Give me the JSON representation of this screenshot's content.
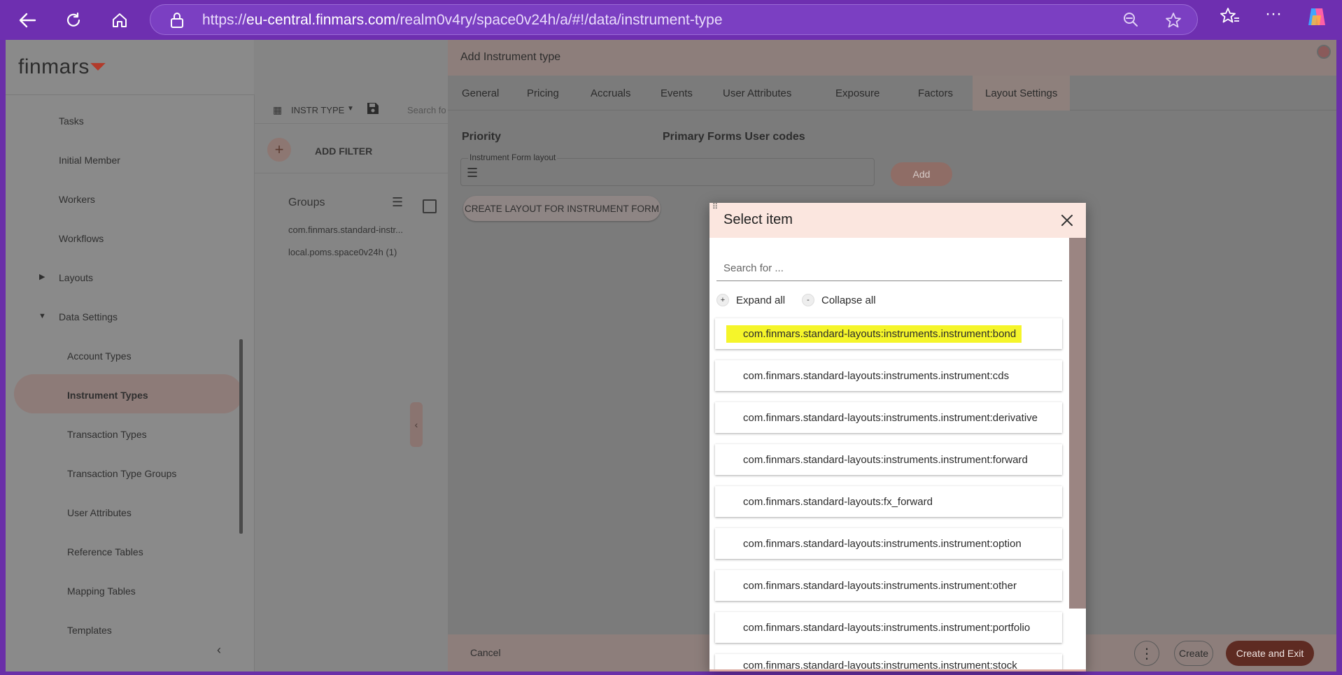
{
  "browser": {
    "url_prefix": "https://",
    "url_domain": "eu-central.finmars.com",
    "url_path": "/realm0v4ry/space0v24h/a/#!/data/instrument-type",
    "icons": [
      "back-arrow-icon",
      "refresh-icon",
      "home-icon",
      "lock-icon",
      "zoom-out-icon",
      "star-icon",
      "favorites-icon",
      "more-icon",
      "copilot-icon"
    ]
  },
  "app": {
    "logo": "finmars",
    "sidebar": {
      "items": [
        {
          "label": "Tasks"
        },
        {
          "label": "Initial Member"
        },
        {
          "label": "Workers"
        },
        {
          "label": "Workflows"
        },
        {
          "label": "Layouts"
        },
        {
          "label": "Data Settings"
        },
        {
          "label": "Account Types"
        },
        {
          "label": "Instrument Types"
        },
        {
          "label": "Transaction Types"
        },
        {
          "label": "Transaction Type Groups"
        },
        {
          "label": "User Attributes"
        },
        {
          "label": "Reference Tables"
        },
        {
          "label": "Mapping Tables"
        },
        {
          "label": "Templates"
        }
      ]
    },
    "midpanel": {
      "layout_name": "INSTR TYPE",
      "search_placeholder": "Search fo",
      "add_filter": "ADD FILTER",
      "groups_title": "Groups",
      "groups": [
        {
          "label": "com.finmars.standard-instr..."
        },
        {
          "label": "local.poms.space0v24h (1)"
        }
      ]
    }
  },
  "dialog": {
    "title": "Add Instrument type",
    "tabs": [
      {
        "label": "General"
      },
      {
        "label": "Pricing"
      },
      {
        "label": "Accruals"
      },
      {
        "label": "Events"
      },
      {
        "label": "User Attributes"
      },
      {
        "label": "Exposure"
      },
      {
        "label": "Factors"
      },
      {
        "label": "Layout Settings"
      }
    ],
    "active_tab": "Layout Settings",
    "priority_label": "Priority",
    "primary_forms_label": "Primary Forms User codes",
    "form_field_label": "Instrument Form layout",
    "add_button": "Add",
    "create_layout_button": "CREATE LAYOUT FOR INSTRUMENT FORM",
    "footer": {
      "cancel": "Cancel",
      "create": "Create",
      "create_and_exit": "Create and Exit"
    }
  },
  "modal": {
    "title": "Select item",
    "search_placeholder": "Search for ...",
    "expand_all": "Expand all",
    "collapse_all": "Collapse all",
    "expand_symbol": "+",
    "collapse_symbol": "-",
    "items": [
      {
        "label": "com.finmars.standard-layouts:instruments.instrument:bond",
        "highlighted": true
      },
      {
        "label": "com.finmars.standard-layouts:instruments.instrument:cds"
      },
      {
        "label": "com.finmars.standard-layouts:instruments.instrument:derivative"
      },
      {
        "label": "com.finmars.standard-layouts:instruments.instrument:forward"
      },
      {
        "label": "com.finmars.standard-layouts:fx_forward"
      },
      {
        "label": "com.finmars.standard-layouts:instruments.instrument:option"
      },
      {
        "label": "com.finmars.standard-layouts:instruments.instrument:other"
      },
      {
        "label": "com.finmars.standard-layouts:instruments.instrument:portfolio"
      },
      {
        "label": "com.finmars.standard-layouts:instruments.instrument:stock"
      }
    ]
  },
  "colors": {
    "browser_chrome": "#6e2fb0",
    "highlight": "#f5f52a",
    "modal_header": "#fbe6df",
    "primary_button": "#5e2b22"
  }
}
